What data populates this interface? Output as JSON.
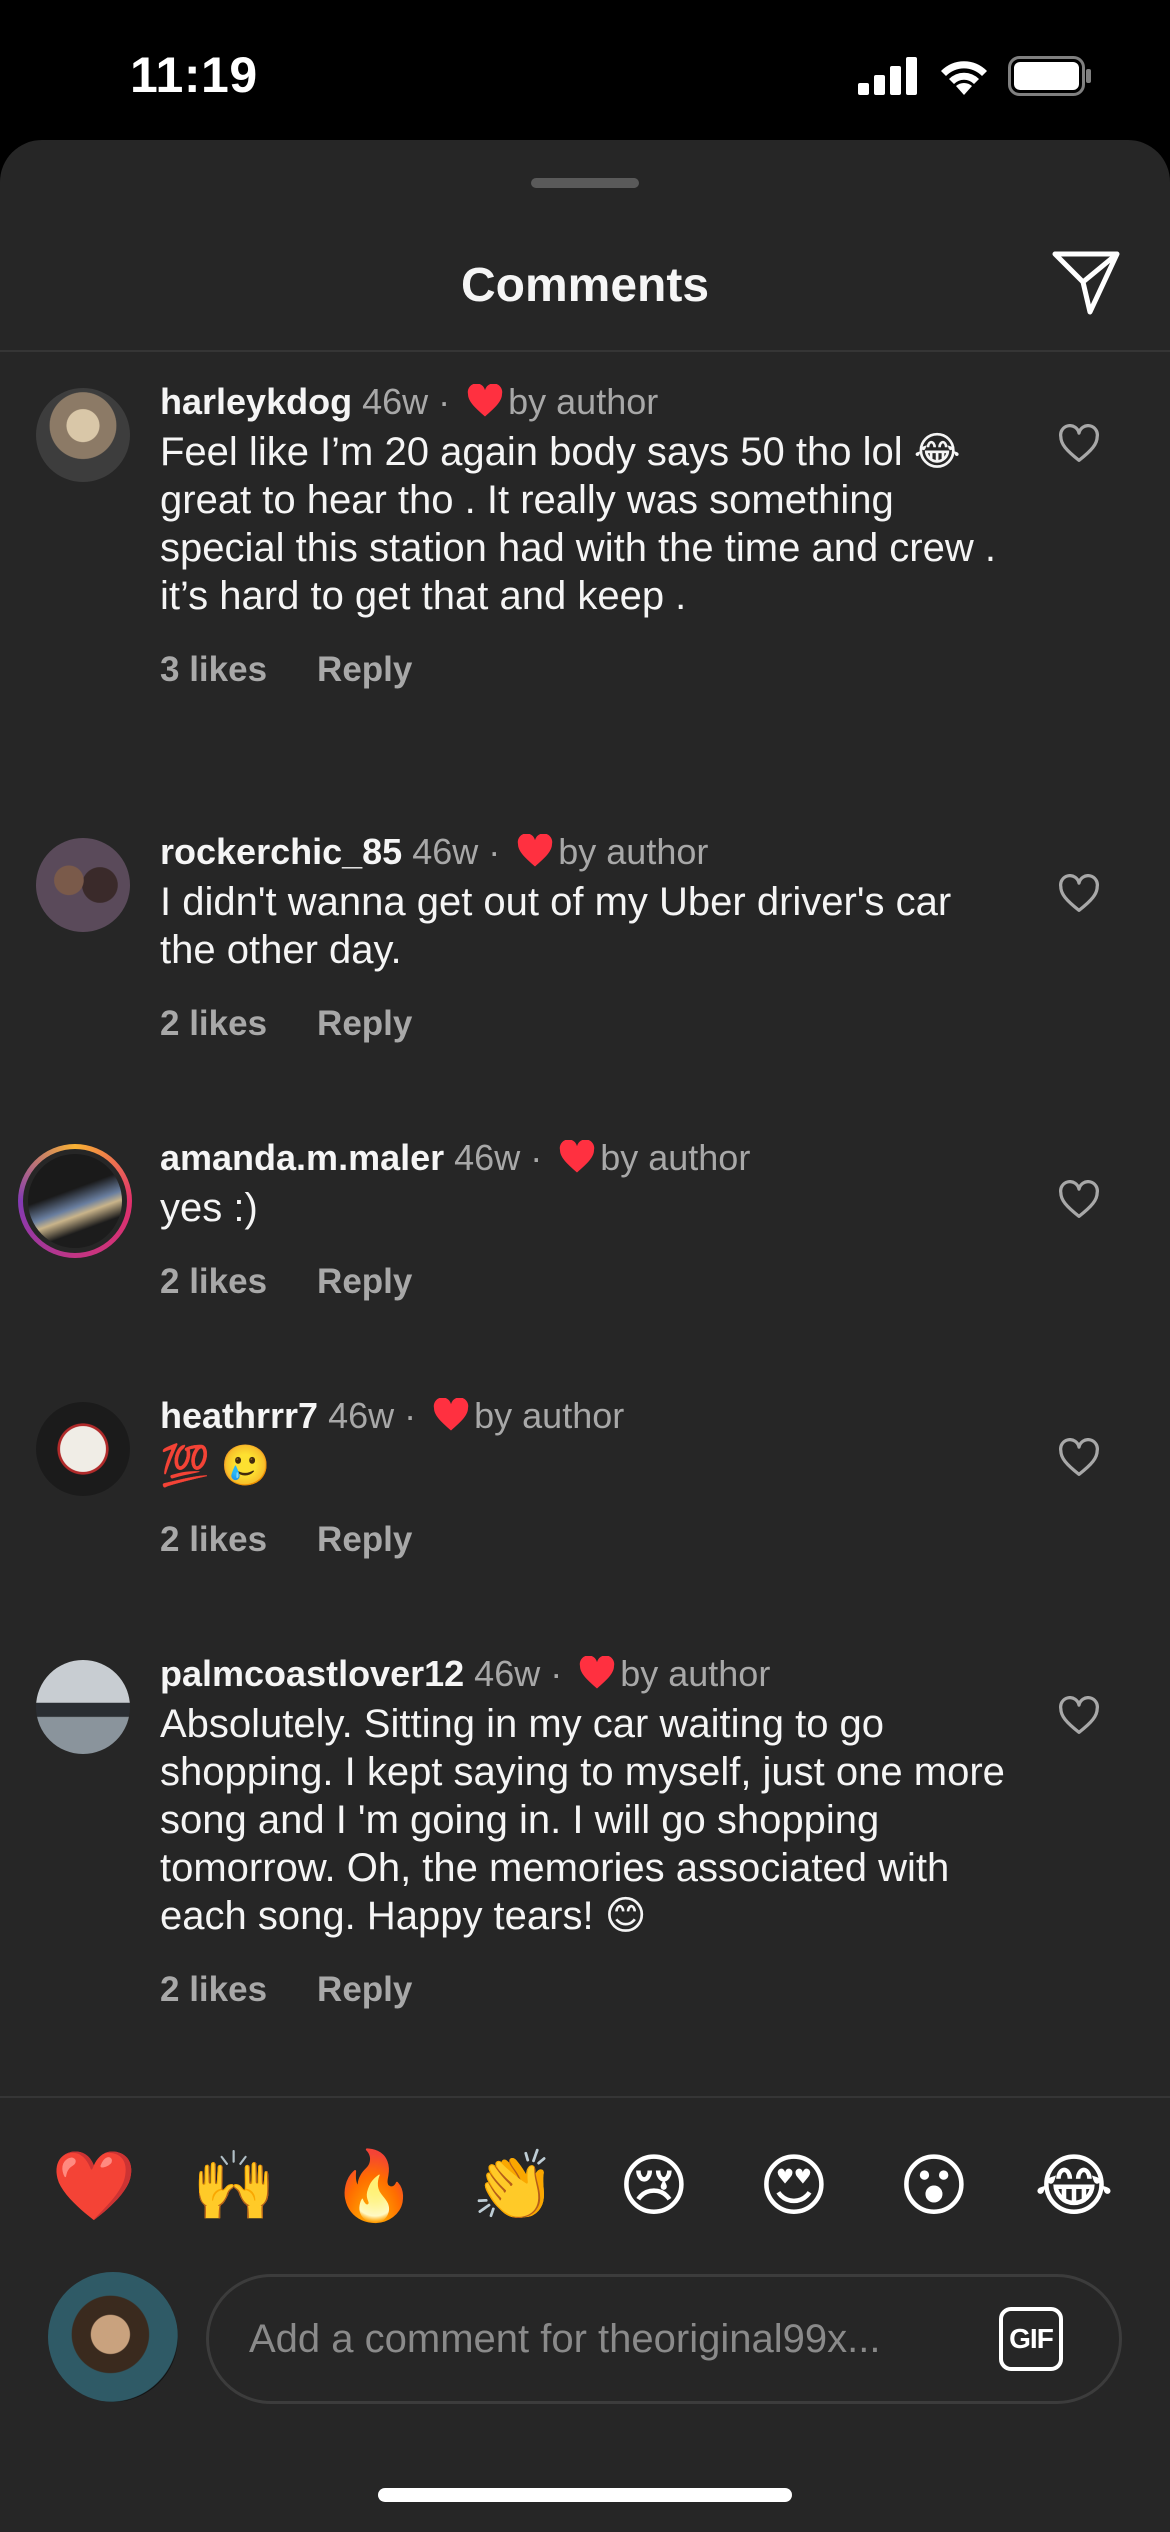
{
  "status_bar": {
    "time": "11:19"
  },
  "sheet": {
    "title": "Comments"
  },
  "comments": [
    {
      "username": "harleykdog",
      "age": "46w",
      "liked_by": "by author",
      "text": "Feel like I’m 20 again body says 50 tho lol 😂 great to hear tho . It really was something special this station had with the time and crew . it’s hard to get that and keep .",
      "likes": "3 likes",
      "reply": "Reply"
    },
    {
      "username": "rockerchic_85",
      "age": "46w",
      "liked_by": "by author",
      "text": "I didn't wanna get out of my Uber driver's car the other day.",
      "likes": "2 likes",
      "reply": "Reply"
    },
    {
      "username": "amanda.m.maler",
      "age": "46w",
      "liked_by": "by author",
      "text": "yes :)",
      "likes": "2 likes",
      "reply": "Reply"
    },
    {
      "username": "heathrrr7",
      "age": "46w",
      "liked_by": "by author",
      "text": "💯 🥲",
      "likes": "2 likes",
      "reply": "Reply"
    },
    {
      "username": "palmcoastlover12",
      "age": "46w",
      "liked_by": "by author",
      "text": "Absolutely.  Sitting in my car waiting to go shopping. I kept saying to myself, just one more song and I 'm going in. I will go shopping tomorrow. Oh, the memories associated with each song. Happy tears! 😊",
      "likes": "2 likes",
      "reply": "Reply"
    }
  ],
  "emoji_bar": [
    "❤️",
    "🙌",
    "🔥",
    "👏",
    "😢",
    "😍",
    "😮",
    "😂"
  ],
  "input": {
    "placeholder": "Add a comment for theoriginal99x...",
    "gif_label": "GIF"
  },
  "colors": {
    "sheet_bg": "#262626",
    "like_red": "#ff3040",
    "muted": "#a8a8a8"
  }
}
